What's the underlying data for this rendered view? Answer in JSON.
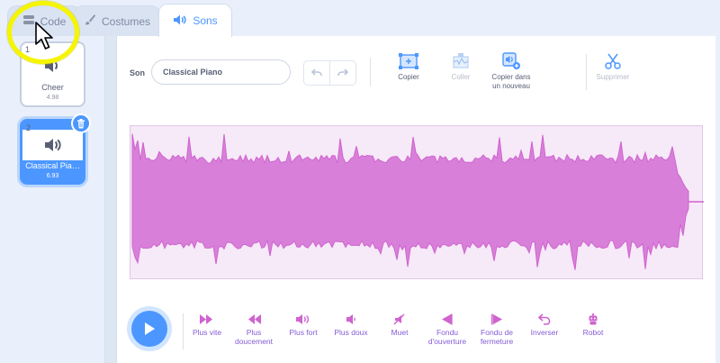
{
  "tabs": [
    {
      "label": "Code",
      "icon": "code-icon"
    },
    {
      "label": "Costumes",
      "icon": "brush-icon"
    },
    {
      "label": "Sons",
      "icon": "sound-icon"
    }
  ],
  "sounds": [
    {
      "number": "1",
      "name": "Cheer",
      "duration": "4.98"
    },
    {
      "number": "2",
      "name": "Classical Pia…",
      "duration": "6.93"
    }
  ],
  "editor": {
    "sound_label": "Son",
    "sound_name": "Classical Piano",
    "tools": {
      "copy": "Copier",
      "paste": "Coller",
      "copy_new_line1": "Copier dans",
      "copy_new_line2": "un nouveau",
      "delete": "Supprimer"
    }
  },
  "effects": [
    {
      "line1": "Plus vite",
      "line2": ""
    },
    {
      "line1": "Plus",
      "line2": "doucement"
    },
    {
      "line1": "Plus fort",
      "line2": ""
    },
    {
      "line1": "Plus doux",
      "line2": ""
    },
    {
      "line1": "Muet",
      "line2": ""
    },
    {
      "line1": "Fondu",
      "line2": "d'ouverture"
    },
    {
      "line1": "Fondu de",
      "line2": "fermeture"
    },
    {
      "line1": "Inverser",
      "line2": ""
    },
    {
      "line1": "Robot",
      "line2": ""
    }
  ],
  "colors": {
    "accent": "#4c97ff",
    "sound_purple": "#cf63cf",
    "effect_purple": "#855cd6",
    "wave_bg": "#f6e9f8",
    "highlight": "#f5f500"
  }
}
